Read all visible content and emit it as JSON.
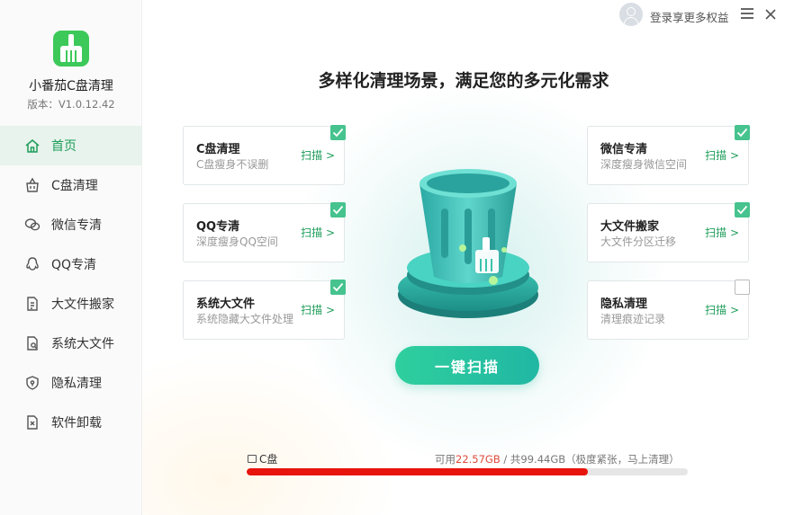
{
  "app": {
    "name": "小番茄C盘清理",
    "version": "版本：V1.0.12.42"
  },
  "sidebar": {
    "items": [
      {
        "label": "首页",
        "icon": "home-icon",
        "active": true
      },
      {
        "label": "C盘清理",
        "icon": "basket-icon"
      },
      {
        "label": "微信专清",
        "icon": "wechat-icon"
      },
      {
        "label": "QQ专清",
        "icon": "qq-icon"
      },
      {
        "label": "大文件搬家",
        "icon": "file-move-icon"
      },
      {
        "label": "系统大文件",
        "icon": "system-file-icon"
      },
      {
        "label": "隐私清理",
        "icon": "shield-icon"
      },
      {
        "label": "软件卸载",
        "icon": "uninstall-icon"
      }
    ]
  },
  "topbar": {
    "login_text": "登录享更多权益"
  },
  "main": {
    "title": "多样化清理场景，满足您的多元化需求",
    "cards": [
      {
        "title": "C盘清理",
        "subtitle": "C盘瘦身不误删",
        "scan": "扫描 >",
        "checked": true
      },
      {
        "title": "QQ专清",
        "subtitle": "深度瘦身QQ空间",
        "scan": "扫描 >",
        "checked": true
      },
      {
        "title": "系统大文件",
        "subtitle": "系统隐藏大文件处理",
        "scan": "扫描 >",
        "checked": true
      },
      {
        "title": "微信专清",
        "subtitle": "深度瘦身微信空间",
        "scan": "扫描 >",
        "checked": true
      },
      {
        "title": "大文件搬家",
        "subtitle": "大文件分区迁移",
        "scan": "扫描 >",
        "checked": true
      },
      {
        "title": "隐私清理",
        "subtitle": "清理痕迹记录",
        "scan": "扫描 >",
        "checked": false
      }
    ],
    "scan_button": "一键扫描"
  },
  "disk": {
    "label": "C盘",
    "free_prefix": "可用",
    "free": "22.57GB",
    "total_text": " /  共99.44GB（极度紧张，马上清理）",
    "used_fraction": 0.773
  },
  "colors": {
    "accent": "#1e9d5a",
    "scan_button": "#2fcf9e",
    "disk_bar": "#e8140e"
  }
}
